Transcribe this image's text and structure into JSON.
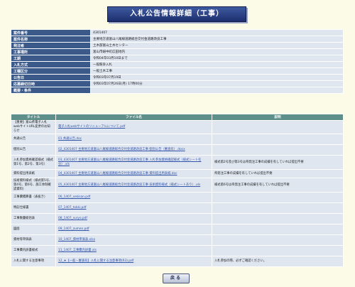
{
  "page": {
    "title": "入札公告情報詳細（工事）"
  },
  "info_rows": [
    {
      "label": "案件番号",
      "value": "4301407"
    },
    {
      "label": "案件名称",
      "value": "主要地方道富山八尾線道路総合交付金道路改良工事"
    },
    {
      "label": "発注者",
      "value": "土木部富山土木センター"
    },
    {
      "label": "工事場所",
      "value": "富山市婦中町広田地内"
    },
    {
      "label": "工期",
      "value": "令和04年03月10日まで"
    },
    {
      "label": "入札方式",
      "value": "一般競争入札"
    },
    {
      "label": "工種区分",
      "value": "一般土木工事"
    },
    {
      "label": "公告日",
      "value": "令和03年07月19日"
    },
    {
      "label": "応募締切日時",
      "value": "令和03年07月26日(月) 17時00分"
    },
    {
      "label": "概要・条件",
      "value": ""
    }
  ],
  "docs": {
    "headers": {
      "title": "タイトル",
      "file": "ファイル名",
      "desc": "説明"
    },
    "rows": [
      {
        "title": "【重要】富山県電子入札webサイトURL変更のお知らせ",
        "file": "電子入札webサイトのリニューアルについて.pdf",
        "desc": ""
      },
      {
        "title": "共通公告",
        "file": "01 共通公告.doc",
        "desc": ""
      },
      {
        "title": "個別公告",
        "file": "02_4301407 主要地方道富山八尾線道路総合交付金道路改良工事 個別公告（審査有）.docx",
        "desc": ""
      },
      {
        "title": "入札参加資格確認様式（様式第1号、第2号、第3号）",
        "file": "03_4301407 主要地方道富山八尾線道路総合交付金道路改良工事 入札参加資格確認様式（様式シート名分）.xls",
        "desc": "様式第2号及び第3号は県発注工事の成績を有していれば提出不要"
      },
      {
        "title": "資料提出用表紙",
        "file": "04_4301407 主要地方道富山八尾線道路総合交付金道路改良工事 資料提出用表紙.doc",
        "desc": "県発注工事の成績を有していれば提出不要"
      },
      {
        "title": "技術資料様式（様式第5号、第4号、第6号、施工体制確認資料）",
        "file": "05_4301407 主要地方道富山八尾線道路総合交付金道路改良工事 技術資料様式（様式シートあり）.xls",
        "desc": "様式第6号は県発注工事の成績を有していれば提出不要"
      },
      {
        "title": "工事費積算書（表抜き）",
        "file": "06_1407_sekisan.pdf",
        "desc": ""
      },
      {
        "title": "特記仕様書",
        "file": "07_1407_tokki.pdf",
        "desc": ""
      },
      {
        "title": "工事数量総括表",
        "file": "08_1407_suryo.pdf",
        "desc": ""
      },
      {
        "title": "図面",
        "file": "09_1407_zumen.pdf",
        "desc": ""
      },
      {
        "title": "資材等単価表",
        "file": "10_1407_資材単価表.xlsx",
        "desc": ""
      },
      {
        "title": "工事費内訳書様式",
        "file": "11_1407_工事費内訳書.xls",
        "desc": ""
      },
      {
        "title": "入札に関する注意事項",
        "file": "12_★【一般・審査有】入札に関する注意事項(R3).pdf",
        "desc": "入札参加の際、必ずご確認ください。"
      }
    ]
  },
  "back_button": "戻る"
}
